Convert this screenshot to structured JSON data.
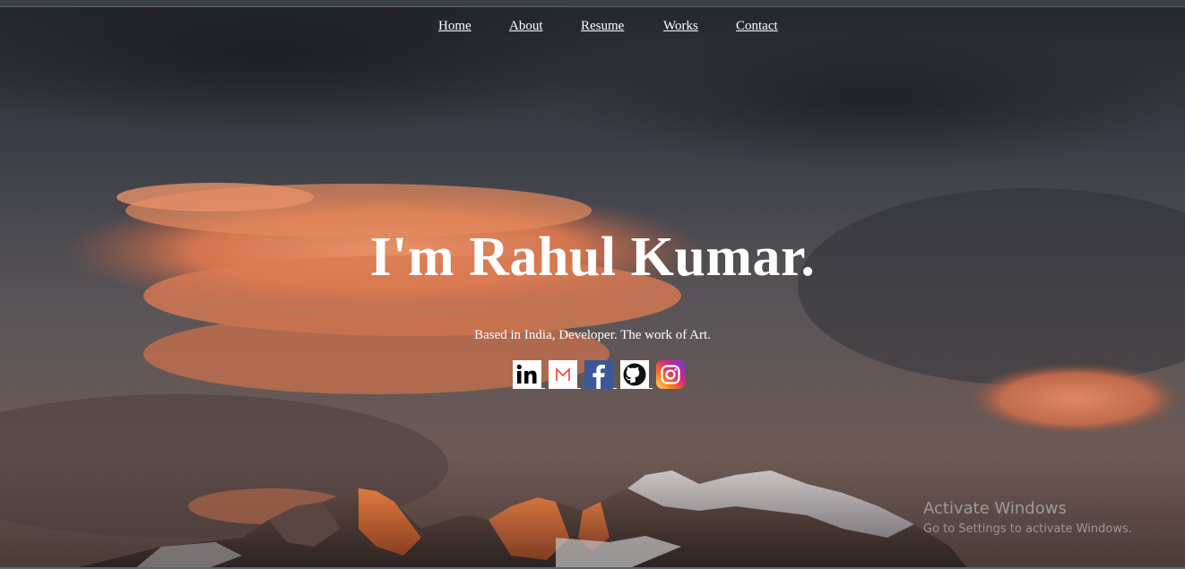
{
  "nav": {
    "items": [
      {
        "label": "Home"
      },
      {
        "label": "About"
      },
      {
        "label": "Resume"
      },
      {
        "label": "Works"
      },
      {
        "label": "Contact"
      }
    ]
  },
  "hero": {
    "title": "I'm Rahul Kumar.",
    "subtitle": "Based in India, Developer. The work of Art."
  },
  "socials": [
    {
      "name": "linkedin",
      "icon": "linkedin-icon",
      "glyph": "in"
    },
    {
      "name": "gmail",
      "icon": "gmail-icon",
      "glyph": "M"
    },
    {
      "name": "facebook",
      "icon": "facebook-icon",
      "glyph": "f"
    },
    {
      "name": "github",
      "icon": "github-icon"
    },
    {
      "name": "instagram",
      "icon": "instagram-icon"
    }
  ],
  "watermark": {
    "title": "Activate Windows",
    "subtitle": "Go to Settings to activate Windows."
  },
  "colors": {
    "text": "#ffffff",
    "linkedin": "#0a66c2",
    "gmail_red": "#ea4335",
    "facebook": "#3b5998"
  }
}
